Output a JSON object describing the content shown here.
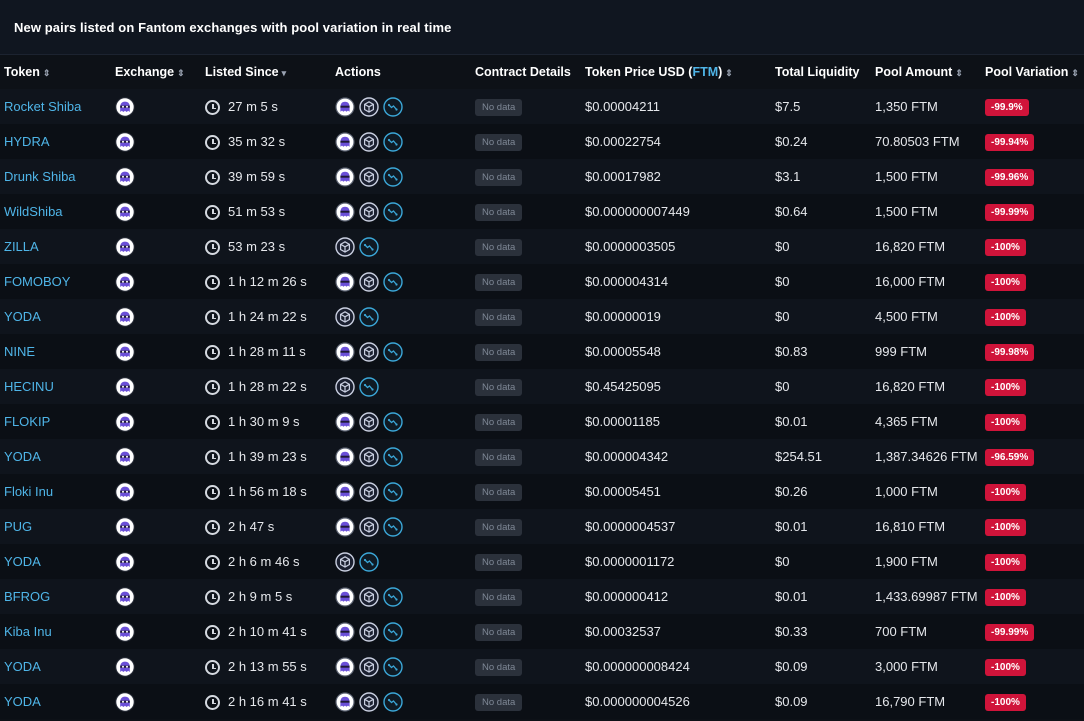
{
  "title": "New pairs listed on Fantom exchanges with pool variation in real time",
  "colors": {
    "accent": "#4fb5e8",
    "negative": "#d0143a",
    "background": "#0d1117"
  },
  "columns": {
    "token": "Token",
    "exchange": "Exchange",
    "listed_since": "Listed Since",
    "actions": "Actions",
    "contract_details": "Contract Details",
    "token_price_prefix": "Token Price USD (",
    "token_price_unit": "FTM",
    "token_price_suffix": ")",
    "total_liquidity": "Total Liquidity",
    "pool_amount": "Pool Amount",
    "pool_variation": "Pool Variation"
  },
  "icons": {
    "sort": "sort-icon",
    "exchange": "spookyswap-ghost-icon",
    "clock": "clock-icon",
    "action_ghost": "ghost-icon",
    "action_cube": "cube-icon",
    "action_chart": "chart-icon"
  },
  "rows": [
    {
      "token": "Rocket Shiba",
      "since": "27 m 5 s",
      "ghost": true,
      "contract": "No data",
      "price": "$0.00004211",
      "liquidity": "$7.5",
      "pool": "1,350 FTM",
      "variation": "-99.9%"
    },
    {
      "token": "HYDRA",
      "since": "35 m 32 s",
      "ghost": true,
      "contract": "No data",
      "price": "$0.00022754",
      "liquidity": "$0.24",
      "pool": "70.80503 FTM",
      "variation": "-99.94%"
    },
    {
      "token": "Drunk Shiba",
      "since": "39 m 59 s",
      "ghost": true,
      "contract": "No data",
      "price": "$0.00017982",
      "liquidity": "$3.1",
      "pool": "1,500 FTM",
      "variation": "-99.96%"
    },
    {
      "token": "WildShiba",
      "since": "51 m 53 s",
      "ghost": true,
      "contract": "No data",
      "price": "$0.000000007449",
      "liquidity": "$0.64",
      "pool": "1,500 FTM",
      "variation": "-99.99%"
    },
    {
      "token": "ZILLA",
      "since": "53 m 23 s",
      "ghost": false,
      "contract": "No data",
      "price": "$0.0000003505",
      "liquidity": "$0",
      "pool": "16,820 FTM",
      "variation": "-100%"
    },
    {
      "token": "FOMOBOY",
      "since": "1 h 12 m 26 s",
      "ghost": true,
      "contract": "No data",
      "price": "$0.000004314",
      "liquidity": "$0",
      "pool": "16,000 FTM",
      "variation": "-100%"
    },
    {
      "token": "YODA",
      "since": "1 h 24 m 22 s",
      "ghost": false,
      "contract": "No data",
      "price": "$0.00000019",
      "liquidity": "$0",
      "pool": "4,500 FTM",
      "variation": "-100%"
    },
    {
      "token": "NINE",
      "since": "1 h 28 m 11 s",
      "ghost": true,
      "contract": "No data",
      "price": "$0.00005548",
      "liquidity": "$0.83",
      "pool": "999 FTM",
      "variation": "-99.98%"
    },
    {
      "token": "HECINU",
      "since": "1 h 28 m 22 s",
      "ghost": false,
      "contract": "No data",
      "price": "$0.45425095",
      "liquidity": "$0",
      "pool": "16,820 FTM",
      "variation": "-100%"
    },
    {
      "token": "FLOKIP",
      "since": "1 h 30 m 9 s",
      "ghost": true,
      "contract": "No data",
      "price": "$0.00001185",
      "liquidity": "$0.01",
      "pool": "4,365 FTM",
      "variation": "-100%"
    },
    {
      "token": "YODA",
      "since": "1 h 39 m 23 s",
      "ghost": true,
      "contract": "No data",
      "price": "$0.000004342",
      "liquidity": "$254.51",
      "pool": "1,387.34626 FTM",
      "variation": "-96.59%"
    },
    {
      "token": "Floki Inu",
      "since": "1 h 56 m 18 s",
      "ghost": true,
      "contract": "No data",
      "price": "$0.00005451",
      "liquidity": "$0.26",
      "pool": "1,000 FTM",
      "variation": "-100%"
    },
    {
      "token": "PUG",
      "since": "2 h 47 s",
      "ghost": true,
      "contract": "No data",
      "price": "$0.0000004537",
      "liquidity": "$0.01",
      "pool": "16,810 FTM",
      "variation": "-100%"
    },
    {
      "token": "YODA",
      "since": "2 h 6 m 46 s",
      "ghost": false,
      "contract": "No data",
      "price": "$0.0000001172",
      "liquidity": "$0",
      "pool": "1,900 FTM",
      "variation": "-100%"
    },
    {
      "token": "BFROG",
      "since": "2 h 9 m 5 s",
      "ghost": true,
      "contract": "No data",
      "price": "$0.000000412",
      "liquidity": "$0.01",
      "pool": "1,433.69987 FTM",
      "variation": "-100%"
    },
    {
      "token": "Kiba Inu",
      "since": "2 h 10 m 41 s",
      "ghost": true,
      "contract": "No data",
      "price": "$0.00032537",
      "liquidity": "$0.33",
      "pool": "700 FTM",
      "variation": "-99.99%"
    },
    {
      "token": "YODA",
      "since": "2 h 13 m 55 s",
      "ghost": true,
      "contract": "No data",
      "price": "$0.000000008424",
      "liquidity": "$0.09",
      "pool": "3,000 FTM",
      "variation": "-100%"
    },
    {
      "token": "YODA",
      "since": "2 h 16 m 41 s",
      "ghost": true,
      "contract": "No data",
      "price": "$0.000000004526",
      "liquidity": "$0.09",
      "pool": "16,790 FTM",
      "variation": "-100%"
    }
  ]
}
